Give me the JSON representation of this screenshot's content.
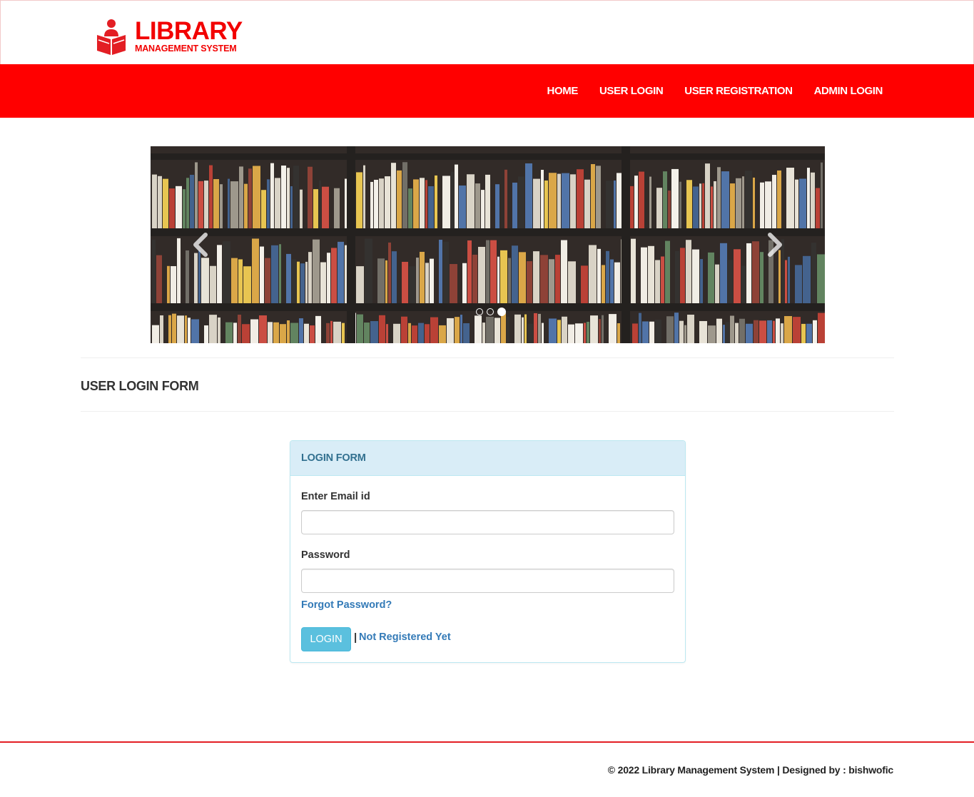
{
  "brand": {
    "title": "LIBRARY",
    "subtitle": "MANAGEMENT SYSTEM",
    "color": "#f20000"
  },
  "nav": {
    "background": "#ff0000",
    "items": [
      {
        "label": "HOME"
      },
      {
        "label": "USER LOGIN"
      },
      {
        "label": "USER REGISTRATION"
      },
      {
        "label": "ADMIN LOGIN"
      }
    ]
  },
  "carousel": {
    "slide_count": 3,
    "active_index": 2,
    "prev_icon": "chevron-left-icon",
    "next_icon": "chevron-right-icon"
  },
  "page": {
    "title": "USER LOGIN FORM"
  },
  "login_form": {
    "heading": "LOGIN FORM",
    "email_label": "Enter Email id",
    "email_value": "",
    "password_label": "Password",
    "password_value": "",
    "forgot_link": "Forgot Password?",
    "login_button": "LOGIN",
    "separator": "|",
    "register_link": "Not Registered Yet"
  },
  "footer": {
    "text": "© 2022 Library Management System | Designed by : bishwofic"
  }
}
